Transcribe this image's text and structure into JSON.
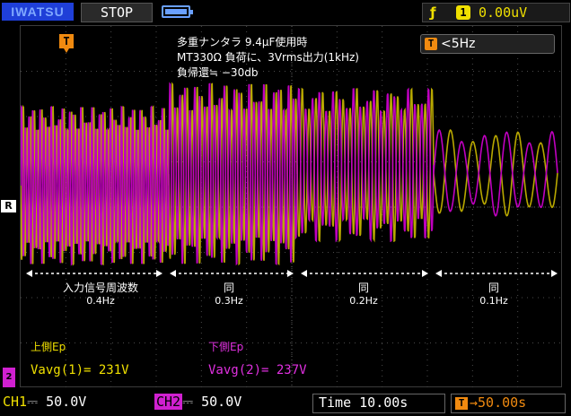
{
  "topbar": {
    "brand": "IWATSU",
    "run_state": "STOP",
    "trigger": {
      "edge_symbol": "ƒ",
      "channel": "1",
      "level": "0.00uV"
    }
  },
  "screen": {
    "trigger_marker": "T",
    "filter": {
      "badge": "T",
      "label": "<5Hz"
    },
    "notes": [
      "多重ナンタラ 9.4μF使用時",
      "MT330Ω 負荷に、3Vrms出力(1kHz)",
      "負帰還≒ −30db"
    ],
    "ref_marker": "R",
    "segments": [
      {
        "title": "入力信号周波数",
        "freq": "0.4Hz"
      },
      {
        "title": "同",
        "freq": "0.3Hz"
      },
      {
        "title": "同",
        "freq": "0.2Hz"
      },
      {
        "title": "同",
        "freq": "0.1Hz"
      }
    ],
    "upper_label": "上側Ep",
    "lower_label": "下側Ep",
    "vavg1": "Vavg(1)= 231V",
    "vavg2": "Vavg(2)= 237V",
    "ch2_marker": "2"
  },
  "bottombar": {
    "ch1_label": "CH1",
    "ch1_coupling": "⎓",
    "ch1_scale": "50.0V",
    "ch2_label": "CH2",
    "ch2_coupling": "⎓",
    "ch2_scale": "50.0V",
    "time_label": "Time",
    "time_value": "10.00s",
    "delay_badge": "T",
    "delay_value": "→50.00s"
  },
  "colors": {
    "ch1": "#b8a800",
    "ch2": "#c000c0",
    "grid": "#4a4a4a",
    "trigger": "#f08a10"
  }
}
